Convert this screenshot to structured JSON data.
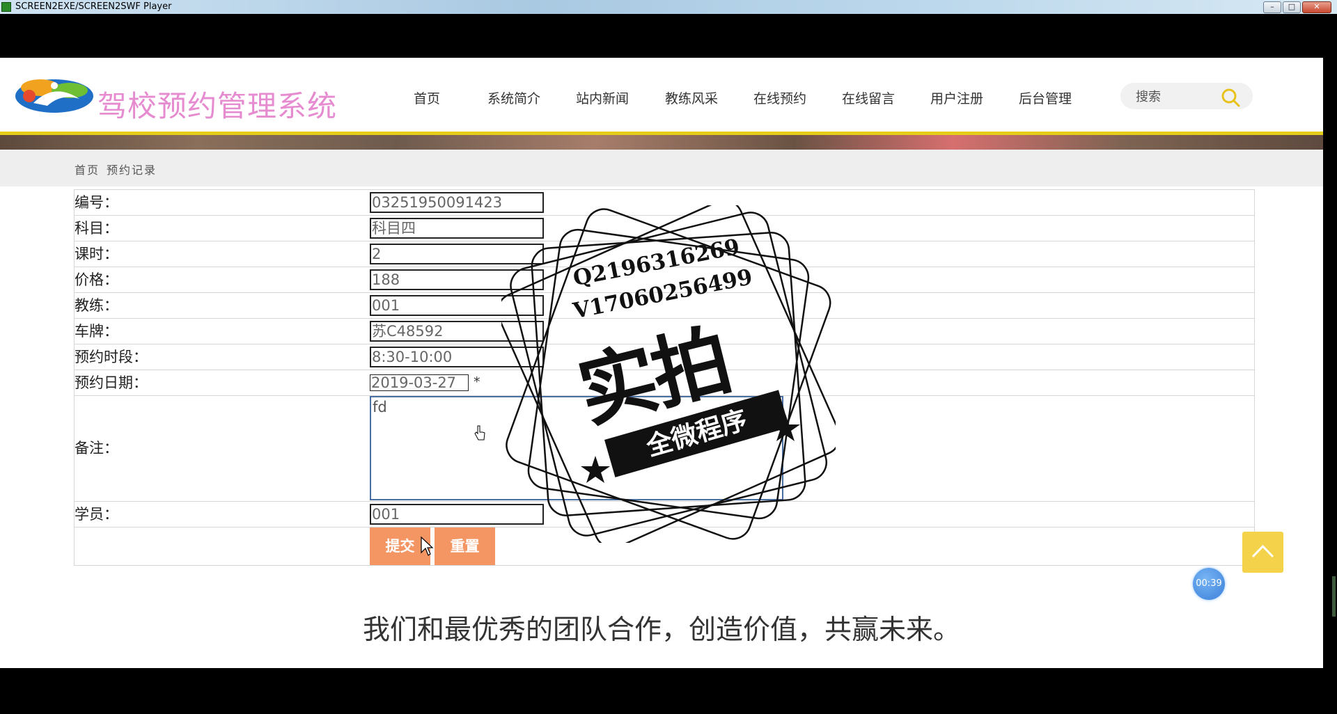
{
  "window": {
    "title": "SCREEN2EXE/SCREEN2SWF Player",
    "minimize": "–",
    "maximize": "□",
    "close": "✕"
  },
  "site": {
    "logo_text": "驾校预约管理系统",
    "nav": [
      "首页",
      "系统简介",
      "站内新闻",
      "教练风采",
      "在线预约",
      "在线留言",
      "用户注册",
      "后台管理"
    ],
    "search_placeholder": "搜索"
  },
  "breadcrumb": [
    "首页",
    "预约记录"
  ],
  "form": {
    "fields": [
      {
        "label": "编号：",
        "value": "03251950091423"
      },
      {
        "label": "科目：",
        "value": "科目四"
      },
      {
        "label": "课时：",
        "value": "2"
      },
      {
        "label": "价格：",
        "value": "188"
      },
      {
        "label": "教练：",
        "value": "001"
      },
      {
        "label": "车牌：",
        "value": "苏C48592"
      },
      {
        "label": "预约时段：",
        "value": "8:30-10:00"
      }
    ],
    "date": {
      "label": "预约日期：",
      "value": "2019-03-27",
      "required_mark": "*"
    },
    "remark": {
      "label": "备注：",
      "value": "fd"
    },
    "student": {
      "label": "学员：",
      "value": "001"
    },
    "submit_label": "提交",
    "reset_label": "重置"
  },
  "slogan": "我们和最优秀的团队合作，创造价值，共赢未来。",
  "timer": "00:39",
  "watermark": {
    "line1": "Q2196316269",
    "line2": "V17060256499",
    "big": "实拍",
    "ribbon": "全微程序"
  },
  "colors": {
    "logo_text": "#e68bd0",
    "accent_line": "#e6cd1a",
    "button": "#f39663",
    "back_to_top": "#f4d34a"
  }
}
